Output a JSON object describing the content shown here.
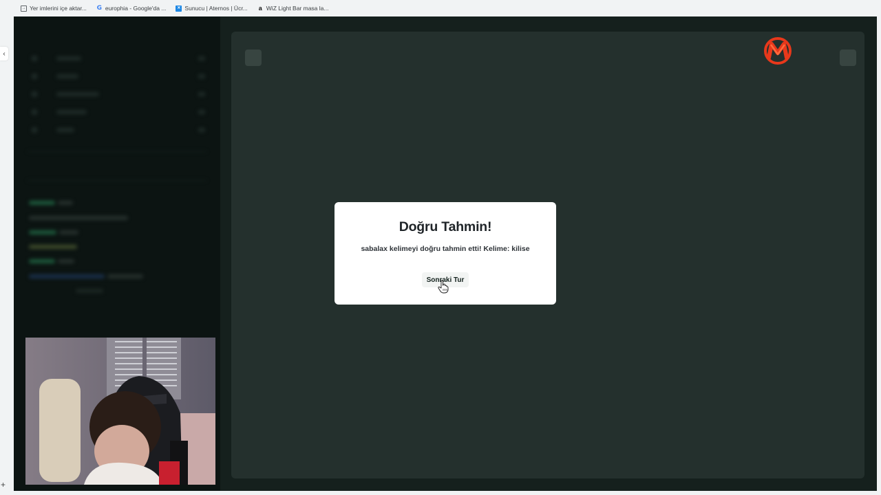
{
  "bookmarks": [
    {
      "label": "Yer imlerini içe aktar...",
      "icon": "import-icon"
    },
    {
      "label": "europhia - Google'da ...",
      "icon": "google-icon"
    },
    {
      "label": "Sunucu | Aternos | Ücr...",
      "icon": "aternos-icon"
    },
    {
      "label": "WiZ Light Bar masa la...",
      "icon": "amazon-icon"
    }
  ],
  "edge": {
    "collapse_glyph": "‹",
    "add_glyph": "+"
  },
  "modal": {
    "title": "Doğru Tahmin!",
    "message": "sabalax kelimeyi doğru tahmin etti! Kelime: kilise",
    "button_label": "Sonraki Tur"
  },
  "colors": {
    "page_bg": "#15201d",
    "sidebar_bg": "#0c1412",
    "main_panel_bg": "#24302d",
    "modal_bg": "#ffffff",
    "logo_red": "#e8381b"
  }
}
